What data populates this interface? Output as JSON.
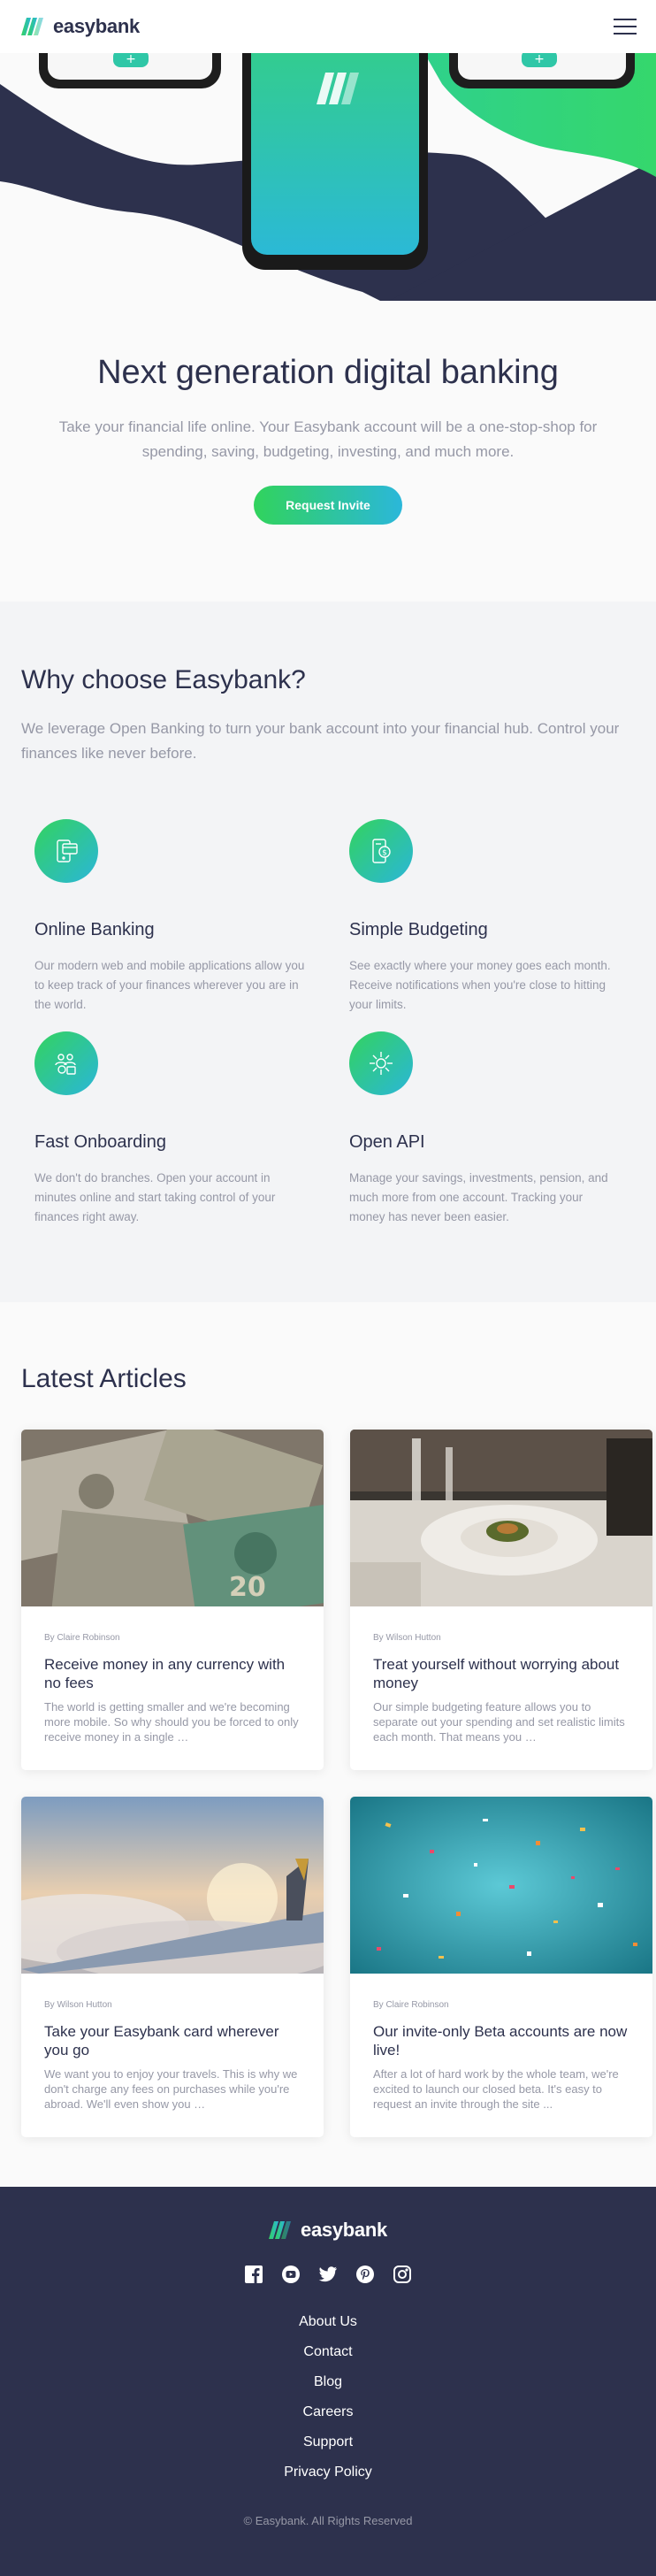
{
  "header": {
    "brand": "easybank",
    "menu_icon": "hamburger-menu-icon"
  },
  "hero": {
    "title": "Next generation digital banking",
    "description": "Take your financial life online. Your Easybank account will be a one-stop-shop for spending, saving, budgeting, investing, and much more.",
    "cta_label": "Request Invite"
  },
  "why": {
    "title": "Why choose Easybank?",
    "description": "We leverage Open Banking to turn your bank account into your financial hub. Control your finances like never before.",
    "features": [
      {
        "icon": "online-banking-icon",
        "title": "Online Banking",
        "description": "Our modern web and mobile applications allow you to keep track of your finances wherever you are in the world."
      },
      {
        "icon": "budgeting-icon",
        "title": "Simple Budgeting",
        "description": "See exactly where your money goes each month. Receive notifications when you're close to hitting your limits."
      },
      {
        "icon": "onboarding-icon",
        "title": "Fast Onboarding",
        "description": "We don't do branches. Open your account in minutes online and start taking control of your finances right away."
      },
      {
        "icon": "api-icon",
        "title": "Open API",
        "description": "Manage your savings, investments, pension, and much more from one account. Tracking your money has never been easier."
      }
    ]
  },
  "articles": {
    "title": "Latest Articles",
    "items": [
      {
        "author": "By Claire Robinson",
        "title": "Receive money in any currency with no fees",
        "excerpt": "The world is getting smaller and we're becoming more mobile. So why should you be forced to only receive money in a single …"
      },
      {
        "author": "By Wilson Hutton",
        "title": "Treat yourself without worrying about money",
        "excerpt": "Our simple budgeting feature allows you to separate out your spending and set realistic limits each month. That means you …"
      },
      {
        "author": "By Wilson Hutton",
        "title": "Take your Easybank card wherever you go",
        "excerpt": "We want you to enjoy your travels. This is why we don't charge any fees on purchases while you're abroad. We'll even show you …"
      },
      {
        "author": "By Claire Robinson",
        "title": "Our invite-only Beta accounts are now live!",
        "excerpt": "After a lot of hard work by the whole team, we're excited to launch our closed beta. It's easy to request an invite through the site ..."
      }
    ]
  },
  "footer": {
    "brand": "easybank",
    "socials": [
      "facebook-icon",
      "youtube-icon",
      "twitter-icon",
      "pinterest-icon",
      "instagram-icon"
    ],
    "links": [
      "About Us",
      "Contact",
      "Blog",
      "Careers",
      "Support",
      "Privacy Policy"
    ],
    "copyright": "© Easybank. All Rights Reserved"
  },
  "colors": {
    "dark_blue": "#2d314d",
    "lime_green": "#31d35c",
    "bright_cyan": "#2bb7da",
    "grayish_blue": "#9698a6"
  }
}
